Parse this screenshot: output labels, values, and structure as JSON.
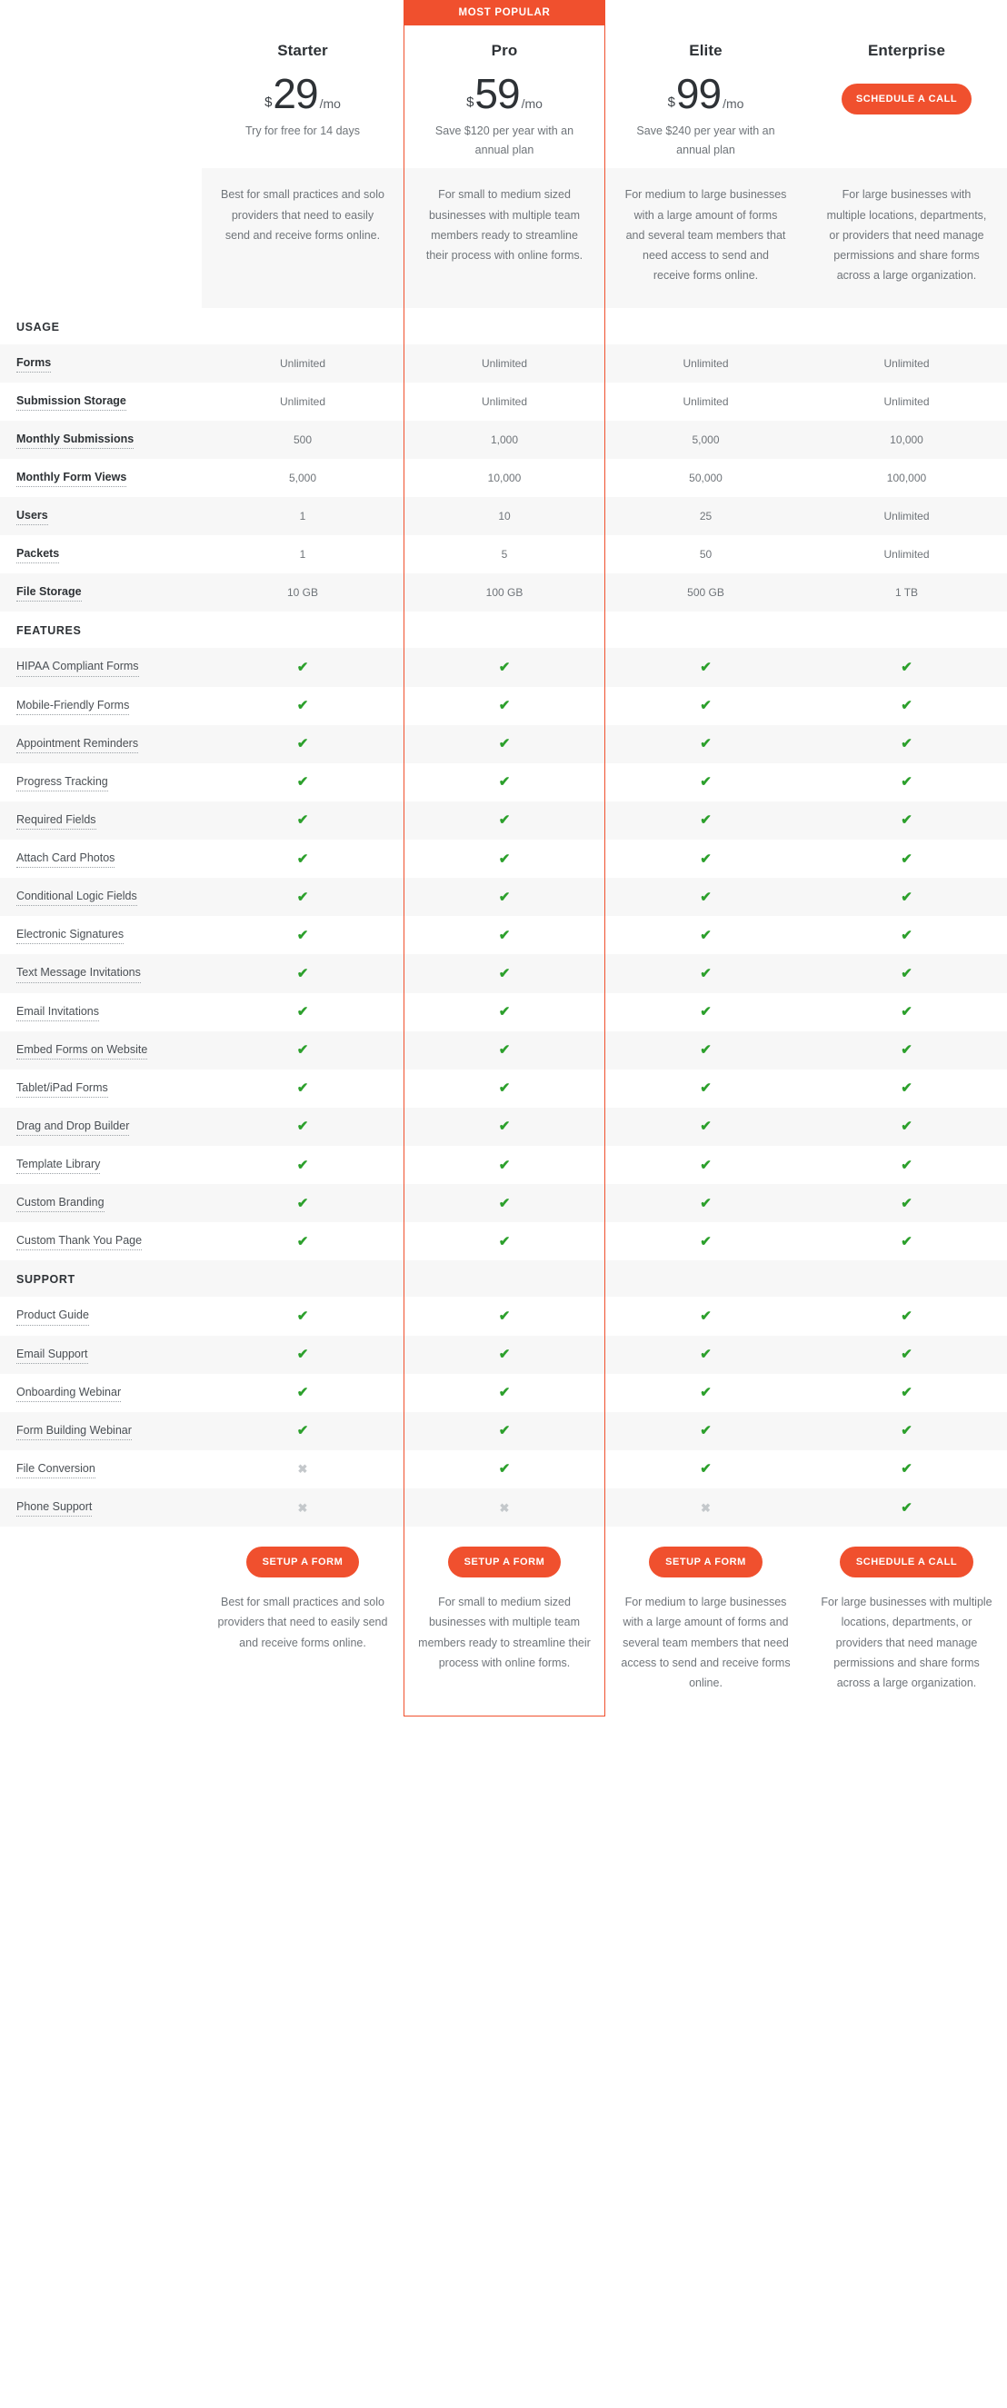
{
  "badge": {
    "label": "MOST POPULAR",
    "color": "#f0502e"
  },
  "accent_color": "#f0502e",
  "check_color": "#2ca02c",
  "cross_color": "#c4c8cb",
  "currency_symbol": "$",
  "plans": [
    {
      "name": "Starter",
      "price": "29",
      "period": "/mo",
      "price_note": "Try for free for 14 days",
      "has_price": true,
      "top_cta": "",
      "description": "Best for small practices and solo providers that need to easily send and receive forms online.",
      "bottom_cta": "SETUP A FORM"
    },
    {
      "name": "Pro",
      "price": "59",
      "period": "/mo",
      "price_note": "Save $120 per year with an annual plan",
      "has_price": true,
      "top_cta": "",
      "description": "For small to medium sized businesses with multiple team members ready to streamline their process with online forms.",
      "bottom_cta": "SETUP A FORM"
    },
    {
      "name": "Elite",
      "price": "99",
      "period": "/mo",
      "price_note": "Save $240 per year with an annual plan",
      "has_price": true,
      "top_cta": "",
      "description": "For medium to large businesses with a large amount of forms and several team members that need access to send and receive forms online.",
      "bottom_cta": "SETUP A FORM"
    },
    {
      "name": "Enterprise",
      "price": "",
      "period": "",
      "price_note": "",
      "has_price": false,
      "top_cta": "SCHEDULE A CALL",
      "description": "For large businesses with multiple locations, departments, or providers that need manage permissions and share forms across a large organization.",
      "bottom_cta": "SCHEDULE A CALL"
    }
  ],
  "sections": [
    {
      "title": "USAGE",
      "bold_labels": true,
      "rows": [
        {
          "label": "Forms",
          "values": [
            "Unlimited",
            "Unlimited",
            "Unlimited",
            "Unlimited"
          ]
        },
        {
          "label": "Submission Storage",
          "values": [
            "Unlimited",
            "Unlimited",
            "Unlimited",
            "Unlimited"
          ]
        },
        {
          "label": "Monthly Submissions",
          "values": [
            "500",
            "1,000",
            "5,000",
            "10,000"
          ]
        },
        {
          "label": "Monthly Form Views",
          "values": [
            "5,000",
            "10,000",
            "50,000",
            "100,000"
          ]
        },
        {
          "label": "Users",
          "values": [
            "1",
            "10",
            "25",
            "Unlimited"
          ]
        },
        {
          "label": "Packets",
          "values": [
            "1",
            "5",
            "50",
            "Unlimited"
          ]
        },
        {
          "label": "File Storage",
          "values": [
            "10 GB",
            "100 GB",
            "500 GB",
            "1 TB"
          ]
        }
      ]
    },
    {
      "title": "FEATURES",
      "bold_labels": false,
      "rows": [
        {
          "label": "HIPAA Compliant Forms",
          "values": [
            "yes",
            "yes",
            "yes",
            "yes"
          ]
        },
        {
          "label": "Mobile-Friendly Forms",
          "values": [
            "yes",
            "yes",
            "yes",
            "yes"
          ]
        },
        {
          "label": "Appointment Reminders",
          "values": [
            "yes",
            "yes",
            "yes",
            "yes"
          ]
        },
        {
          "label": "Progress Tracking",
          "values": [
            "yes",
            "yes",
            "yes",
            "yes"
          ]
        },
        {
          "label": "Required Fields",
          "values": [
            "yes",
            "yes",
            "yes",
            "yes"
          ]
        },
        {
          "label": "Attach Card Photos",
          "values": [
            "yes",
            "yes",
            "yes",
            "yes"
          ]
        },
        {
          "label": "Conditional Logic Fields",
          "values": [
            "yes",
            "yes",
            "yes",
            "yes"
          ]
        },
        {
          "label": "Electronic Signatures",
          "values": [
            "yes",
            "yes",
            "yes",
            "yes"
          ]
        },
        {
          "label": "Text Message Invitations",
          "values": [
            "yes",
            "yes",
            "yes",
            "yes"
          ]
        },
        {
          "label": "Email Invitations",
          "values": [
            "yes",
            "yes",
            "yes",
            "yes"
          ]
        },
        {
          "label": "Embed Forms on Website",
          "values": [
            "yes",
            "yes",
            "yes",
            "yes"
          ]
        },
        {
          "label": "Tablet/iPad Forms",
          "values": [
            "yes",
            "yes",
            "yes",
            "yes"
          ]
        },
        {
          "label": "Drag and Drop Builder",
          "values": [
            "yes",
            "yes",
            "yes",
            "yes"
          ]
        },
        {
          "label": "Template Library",
          "values": [
            "yes",
            "yes",
            "yes",
            "yes"
          ]
        },
        {
          "label": "Custom Branding",
          "values": [
            "yes",
            "yes",
            "yes",
            "yes"
          ]
        },
        {
          "label": "Custom Thank You Page",
          "values": [
            "yes",
            "yes",
            "yes",
            "yes"
          ]
        }
      ]
    },
    {
      "title": "SUPPORT",
      "bold_labels": false,
      "rows": [
        {
          "label": "Product Guide",
          "values": [
            "yes",
            "yes",
            "yes",
            "yes"
          ]
        },
        {
          "label": "Email Support",
          "values": [
            "yes",
            "yes",
            "yes",
            "yes"
          ]
        },
        {
          "label": "Onboarding Webinar",
          "values": [
            "yes",
            "yes",
            "yes",
            "yes"
          ]
        },
        {
          "label": "Form Building Webinar",
          "values": [
            "yes",
            "yes",
            "yes",
            "yes"
          ]
        },
        {
          "label": "File Conversion",
          "values": [
            "no",
            "yes",
            "yes",
            "yes"
          ]
        },
        {
          "label": "Phone Support",
          "values": [
            "no",
            "no",
            "no",
            "yes"
          ]
        }
      ]
    }
  ],
  "glyphs": {
    "check": "✔",
    "cross": "✖"
  }
}
